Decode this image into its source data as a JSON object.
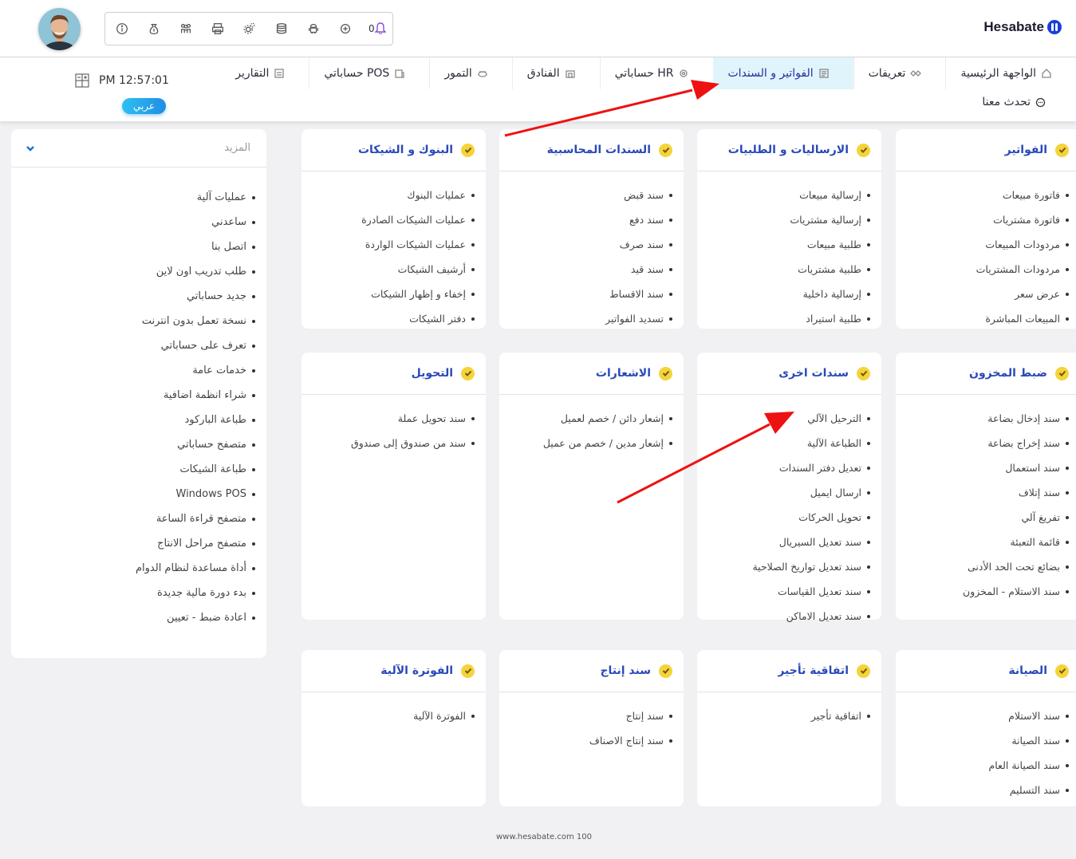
{
  "header": {
    "logo_text": "Hesabate",
    "notification_count": "0",
    "toolbar_icons": [
      "info-icon",
      "money-bag-icon",
      "users-icon",
      "printer-icon",
      "gears-icon",
      "database-icon",
      "android-icon",
      "plus-circle-icon",
      "bell-icon"
    ]
  },
  "nav": {
    "items": [
      {
        "label": "الواجهة الرئيسية",
        "icon": "home-icon"
      },
      {
        "label": "تعريفات",
        "icon": "settings-icon"
      },
      {
        "label": "الفواتير و السندات",
        "icon": "document-icon"
      },
      {
        "label": "حساباتي HR",
        "icon": "dot-icon"
      },
      {
        "label": "الفنادق",
        "icon": "hotel-icon"
      },
      {
        "label": "التمور",
        "icon": "dates-icon"
      },
      {
        "label": "حساباتي POS",
        "icon": "pos-icon"
      },
      {
        "label": "التقارير",
        "icon": "reports-icon"
      }
    ],
    "active_item": "الفواتير و السندات",
    "chat_label": "تحدث معنا",
    "clock": "PM 12:57:01",
    "lang_button": "عربي"
  },
  "sidebar": {
    "header": "المزيد",
    "items": [
      "عمليات آلية",
      "ساعدني",
      "اتصل بنا",
      "طلب تدريب اون لاين",
      "جديد حساباتي",
      "نسخة تعمل بدون انترنت",
      "تعرف على حساباتي",
      "خدمات عامة",
      "شراء انظمة اضافية",
      "طباعة الباركود",
      "متصفح حساباتي",
      "طباعة الشيكات",
      "Windows POS",
      "متصفح قراءة الساعة",
      "متصفح مراحل الانتاج",
      "أداة مساعدة لنظام الدوام",
      "بدء دورة مالية جديدة",
      "اعادة ضبط - تعيين"
    ]
  },
  "cards": [
    {
      "title": "الفواتير",
      "items": [
        "فاتورة مبيعات",
        "فاتورة مشتريات",
        "مردودات المبيعات",
        "مردودات المشتريات",
        "عرض سعر",
        "المبيعات المباشرة"
      ]
    },
    {
      "title": "الارساليات و الطلبيات",
      "items": [
        "إرسالية مبيعات",
        "إرسالية مشتريات",
        "طلبية مبيعات",
        "طلبية مشتريات",
        "إرسالية داخلية",
        "طلبية استيراد"
      ]
    },
    {
      "title": "السندات المحاسبية",
      "items": [
        "سند قبض",
        "سند دفع",
        "سند صرف",
        "سند قيد",
        "سند الاقساط",
        "تسديد الفواتير"
      ]
    },
    {
      "title": "البنوك و الشيكات",
      "items": [
        "عمليات البنوك",
        "عمليات الشيكات الصادرة",
        "عمليات الشيكات الواردة",
        "أرشيف الشيكات",
        "إخفاء و إظهار الشيكات",
        "دفتر الشيكات"
      ]
    },
    {
      "title": "ضبط المخزون",
      "items": [
        "سند إدخال بضاعة",
        "سند إخراج بضاعة",
        "سند استعمال",
        "سند إتلاف",
        "تفريغ آلي",
        "قائمة التعبئة",
        "بضائع تحت الحد الأدنى",
        "سند الاستلام - المخزون"
      ]
    },
    {
      "title": "سندات اخرى",
      "items": [
        "الترحيل الآلي",
        "الطباعة الآلية",
        "تعديل دفتر السندات",
        "ارسال ايميل",
        "تحويل الحركات",
        "سند تعديل السيريال",
        "سند تعديل تواريخ الصلاحية",
        "سند تعديل القياسات",
        "سند تعديل الاماكن"
      ]
    },
    {
      "title": "الاشعارات",
      "items": [
        "إشعار دائن / خصم لعميل",
        "إشعار مدين / خصم من عميل"
      ]
    },
    {
      "title": "التحويل",
      "items": [
        "سند تحويل عملة",
        "سند من صندوق إلى صندوق"
      ]
    },
    {
      "title": "الصيانة",
      "items": [
        "سند الاستلام",
        "سند الصيانة",
        "سند الصيانة العام",
        "سند التسليم"
      ]
    },
    {
      "title": "اتفاقية تأجير",
      "items": [
        "اتفاقية تأجير"
      ]
    },
    {
      "title": "سند إنتاج",
      "items": [
        "سند إنتاج",
        "سند إنتاج الاصناف"
      ]
    },
    {
      "title": "الفوترة الآلية",
      "items": [
        "الفوترة الآلية"
      ]
    }
  ],
  "footer": "www.hesabate.com 100",
  "colors": {
    "accent": "#2a49b8",
    "check": "#f5d33b",
    "active_tab_bg": "#dff5fb",
    "arrow": "#ee1111"
  }
}
